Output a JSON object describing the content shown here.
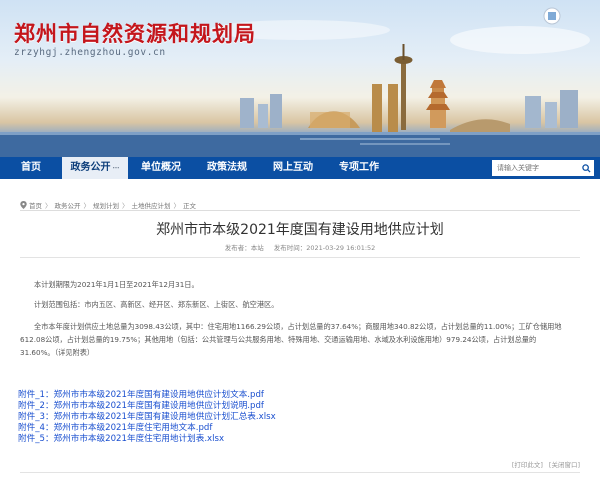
{
  "site": {
    "title": "郑州市自然资源和规划局",
    "url": "zrzyhgj.zhengzhou.gov.cn"
  },
  "nav": {
    "items": [
      {
        "label": "首页"
      },
      {
        "label": "政务公开"
      },
      {
        "label": "单位概况"
      },
      {
        "label": "政策法规"
      },
      {
        "label": "网上互动"
      },
      {
        "label": "专项工作"
      }
    ],
    "active_caret": "⋯",
    "search_placeholder": "请输入关键字"
  },
  "breadcrumb": {
    "items": [
      "首页",
      "政务公开",
      "规划计划",
      "土地供应计划",
      "正文"
    ],
    "separator": "〉"
  },
  "article": {
    "title": "郑州市市本级2021年度国有建设用地供应计划",
    "source": "发布者：本站",
    "date": "发布时间：2021-03-29 16:01:52",
    "paragraphs": [
      "本计划期限为2021年1月1日至2021年12月31日。",
      "计划范围包括：市内五区、高新区、经开区、郑东新区、上街区、航空港区。",
      "全市本年度计划供应土地总量为3098.43公顷，其中：住宅用地1166.29公顷，占计划总量的37.64%；商服用地340.82公顷，占计划总量的11.00%；工矿仓储用地612.08公顷，占计划总量的19.75%；其他用地（包括：公共管理与公共服务用地、特殊用地、交通运输用地、水域及水利设施用地）979.24公顷，占计划总量的31.60%。（详见附表）"
    ],
    "attachments": [
      "附件_1：郑州市市本级2021年度国有建设用地供应计划文本.pdf",
      "附件_2：郑州市市本级2021年度国有建设用地供应计划说明.pdf",
      "附件_3：郑州市市本级2021年度国有建设用地供应计划汇总表.xlsx",
      "附件_4：郑州市市本级2021年度住宅用地文本.pdf",
      "附件_5：郑州市市本级2021年度住宅用地计划表.xlsx"
    ]
  },
  "footer": {
    "print": "[打印此文]",
    "close": "[关闭窗口]"
  },
  "colors": {
    "nav_bg": "#0b4fa3",
    "title_red": "#c4161c",
    "link_blue": "#1a4fcf"
  }
}
